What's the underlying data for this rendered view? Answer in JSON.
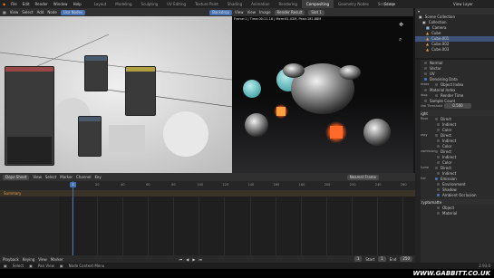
{
  "menubar": {
    "items": [
      "File",
      "Edit",
      "Render",
      "Window",
      "Help"
    ],
    "workspaces": [
      "Layout",
      "Modeling",
      "Sculpting",
      "UV Editing",
      "Texture Paint",
      "Shading",
      "Animation",
      "Rendering",
      "Compositing",
      "Geometry Nodes",
      "Scripting"
    ],
    "active_workspace": "Compositing",
    "scene_label": "Scene",
    "view_layer_label": "View Layer"
  },
  "node_editor": {
    "header": [
      "View",
      "Select",
      "Add",
      "Node"
    ],
    "use_nodes_label": "Use Nodes",
    "backdrop_label": "Backdrop"
  },
  "render_view": {
    "header": [
      "View",
      "View",
      "Image"
    ],
    "result_label": "Render Result",
    "slot_label": "Slot 1",
    "frame_info": "Frame:1 | Time:00:11.18 | Mem:61.02M, Peak:181.88M"
  },
  "outliner": {
    "items": [
      {
        "label": "Scene Collection"
      },
      {
        "label": "Collection"
      },
      {
        "label": "Camera"
      },
      {
        "label": "Cube"
      },
      {
        "label": "Cube.001"
      },
      {
        "label": "Cube.002"
      },
      {
        "label": "Cube.003"
      }
    ]
  },
  "properties": {
    "passes_top": [
      "Normal",
      "Vector",
      "UV",
      "Denoising Data"
    ],
    "indexes_label": "Indexes",
    "indexes": [
      "Object Index",
      "Material Index"
    ],
    "debug_label": "Debug",
    "debug": [
      "Render Time",
      "Sample Count"
    ],
    "alpha_threshold_label": "Alpha Threshold",
    "alpha_threshold_value": "0.500",
    "light_section": "Light",
    "diffuse_label": "Diffuse",
    "diffuse": [
      "Direct",
      "Indirect",
      "Color"
    ],
    "glossy_label": "Glossy",
    "glossy": [
      "Direct",
      "Indirect",
      "Color"
    ],
    "transmission_label": "Transmission",
    "transmission": [
      "Direct",
      "Indirect",
      "Color"
    ],
    "volume_label": "Volume",
    "volume": [
      "Direct",
      "Indirect"
    ],
    "other_label": "Other",
    "other": [
      "Emission",
      "Environment",
      "Shadow",
      "Ambient Occlusion"
    ],
    "cryptomatte_section": "Cryptomatte",
    "cryptomatte": [
      "Object",
      "Material"
    ]
  },
  "timeline": {
    "header": [
      "Dope Sheet",
      "View",
      "Select",
      "Marker",
      "Channel",
      "Key"
    ],
    "summary_label": "Summary",
    "nearest_frame_label": "Nearest Frame",
    "ticks": [
      "0",
      "20",
      "40",
      "60",
      "80",
      "100",
      "120",
      "140",
      "160",
      "180",
      "200",
      "220",
      "240",
      "260"
    ],
    "current_frame": "1",
    "playback_label": "Playback",
    "keying_label": "Keying",
    "view_label": "View",
    "marker_label": "Marker",
    "start_label": "Start",
    "start_value": "1",
    "end_label": "End",
    "end_value": "250"
  },
  "status": {
    "select_label": "Select",
    "pan_label": "Pan View",
    "context_label": "Node Context Menu",
    "version": "2.93.0",
    "watermark": "WWW.GABBITT.CO.UK"
  }
}
